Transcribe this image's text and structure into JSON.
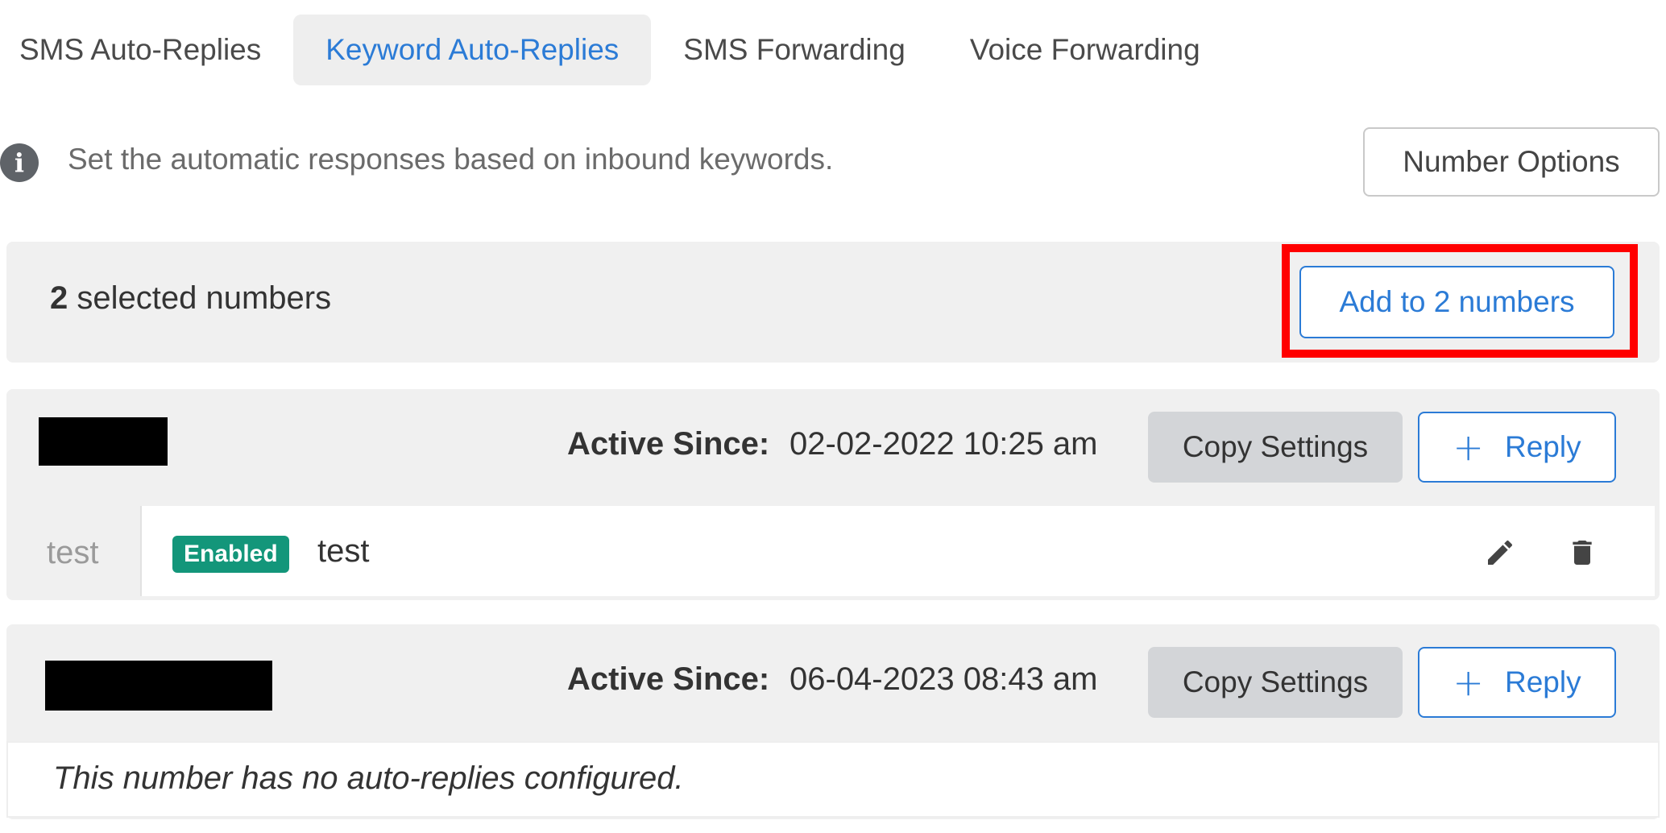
{
  "tabs": [
    {
      "label": "SMS Auto-Replies",
      "active": false
    },
    {
      "label": "Keyword Auto-Replies",
      "active": true
    },
    {
      "label": "SMS Forwarding",
      "active": false
    },
    {
      "label": "Voice Forwarding",
      "active": false
    }
  ],
  "info": {
    "icon": "info-icon",
    "text": "Set the automatic responses based on inbound keywords.",
    "number_options_label": "Number Options"
  },
  "selection": {
    "count": "2",
    "suffix": "selected numbers",
    "add_button_label": "Add to 2 numbers"
  },
  "numbers": [
    {
      "active_since_label": "Active Since:",
      "active_since_value": "02-02-2022 10:25 am",
      "copy_settings_label": "Copy Settings",
      "reply_button_plus": "+",
      "reply_button_label": "Reply",
      "replies": [
        {
          "keyword": "test",
          "status": "Enabled",
          "text": "test"
        }
      ]
    },
    {
      "active_since_label": "Active Since:",
      "active_since_value": "06-04-2023 08:43 am",
      "copy_settings_label": "Copy Settings",
      "reply_button_plus": "+",
      "reply_button_label": "Reply",
      "empty_message": "This number has no auto-replies configured."
    }
  ],
  "colors": {
    "accent": "#2b7bd6",
    "enabled_badge": "#13967a",
    "highlight": "#ff0000",
    "panel_bg": "#f0f0f0"
  }
}
